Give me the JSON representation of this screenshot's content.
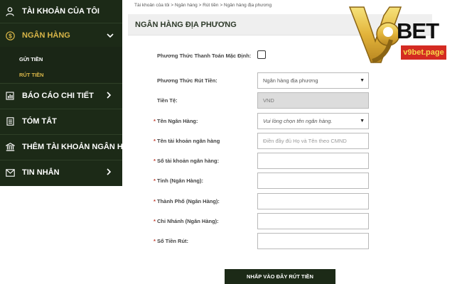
{
  "sidebar": {
    "account": "TÀI KHOẢN CỦA TÔI",
    "bank": "NGÂN HÀNG",
    "deposit": "GỬI TIỀN",
    "withdraw": "RÚT TIỀN",
    "report": "BÁO CÁO CHI TIẾT",
    "summary": "TÓM TẮT",
    "add_bank": "THÊM TÀI KHOẢN NGÂN HÀNG",
    "messages": "TIN NHẮN"
  },
  "breadcrumb": "Tài khoản của tôi > Ngân hàng > Rút tiền > Ngân hàng địa phương",
  "page_title": "NGÂN HÀNG ĐỊA PHƯƠNG",
  "form": {
    "default_method_label": "Phương Thức Thanh Toán Mặc Định:",
    "default_method_checked": false,
    "withdraw_method_label": "Phương Thức Rút Tiền:",
    "withdraw_method_value": "Ngân hàng địa phương",
    "currency_label": "Tiền Tệ:",
    "currency_value": "VND",
    "bank_name_label": "Tên Ngân Hàng:",
    "bank_name_placeholder": "Vui lòng chọn tên ngân hàng.",
    "account_name_label": "Tên tài khoản ngân hàng",
    "account_name_placeholder": "Điền đầy đủ Họ và Tên theo CMND",
    "account_number_label": "Số tài khoản ngân hàng:",
    "province_label": "Tỉnh (Ngân Hàng):",
    "city_label": "Thành Phố (Ngân Hàng):",
    "branch_label": "Chi Nhánh (Ngân Hàng):",
    "amount_label": "Số Tiền Rút:",
    "required_mark": "*",
    "submit": "NHẤP VÀO ĐÂY RÚT TIỀN"
  },
  "logo": {
    "bet": "BET",
    "url": "v9bet.page"
  },
  "colors": {
    "sidebar_bg": "#1c2a17",
    "accent_gold": "#d9b648",
    "logo_red": "#d42b22"
  }
}
